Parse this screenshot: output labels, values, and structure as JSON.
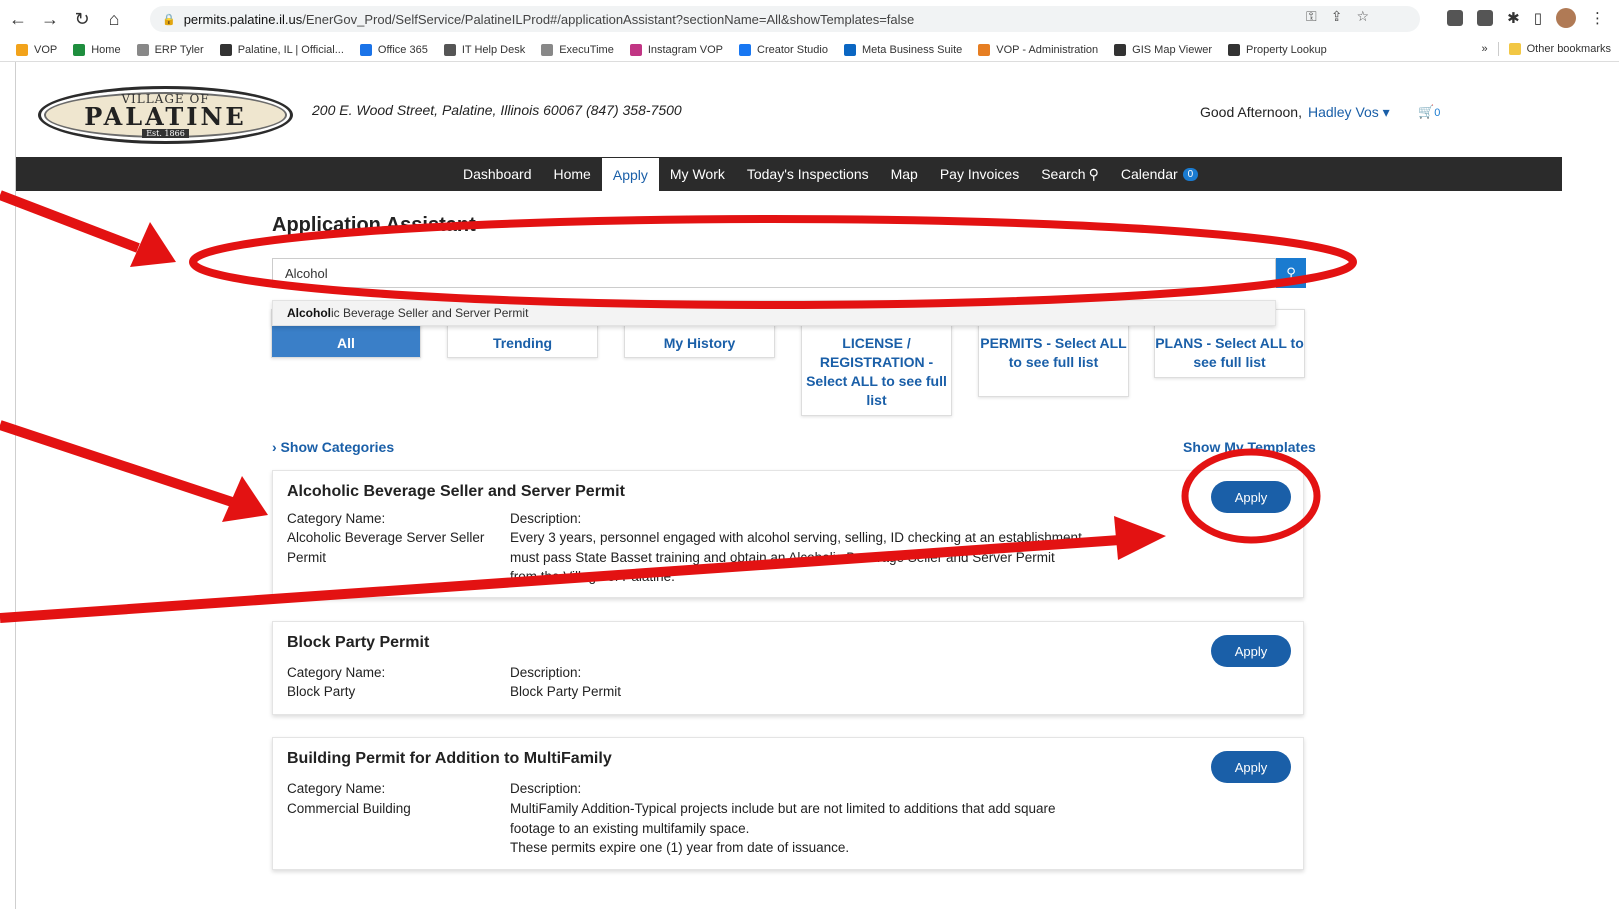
{
  "browser": {
    "url_host": "permits.palatine.il.us",
    "url_path": "/EnerGov_Prod/SelfService/PalatineILProd#/applicationAssistant?sectionName=All&showTemplates=false",
    "bookmarks": [
      {
        "label": "VOP",
        "color": "#f2a31b"
      },
      {
        "label": "Home",
        "color": "#1e8e3e"
      },
      {
        "label": "ERP Tyler",
        "color": "#888888"
      },
      {
        "label": "Palatine, IL | Official...",
        "color": "#333333"
      },
      {
        "label": "Office 365",
        "color": "#1a73e8"
      },
      {
        "label": "IT Help Desk",
        "color": "#555555"
      },
      {
        "label": "ExecuTime",
        "color": "#888888"
      },
      {
        "label": "Instagram VOP",
        "color": "#c13584"
      },
      {
        "label": "Creator Studio",
        "color": "#1877f2"
      },
      {
        "label": "Meta Business Suite",
        "color": "#0a66c2"
      },
      {
        "label": "VOP - Administration",
        "color": "#e67e22"
      },
      {
        "label": "GIS Map Viewer",
        "color": "#333333"
      },
      {
        "label": "Property Lookup",
        "color": "#333333"
      }
    ],
    "bookmarks_overflow": "»",
    "other_bookmarks": "Other bookmarks"
  },
  "header": {
    "logo_line1": "VILLAGE OF",
    "logo_line2": "PALATINE",
    "logo_line3": "Est. 1866",
    "address": "200 E. Wood Street, Palatine, Illinois 60067  (847) 358-7500",
    "greeting": "Good Afternoon,",
    "user_name": "Hadley Vos",
    "cart_count": "0"
  },
  "nav": {
    "items": [
      "Dashboard",
      "Home",
      "Apply",
      "My Work",
      "Today's Inspections",
      "Map",
      "Pay Invoices",
      "Search"
    ],
    "calendar_label": "Calendar",
    "calendar_count": "0"
  },
  "main": {
    "title": "Application Assistant",
    "search_value": "Alcohol",
    "suggestion_match": "Alcohol",
    "suggestion_rest": "ic Beverage Seller and Server Permit",
    "tiles": [
      {
        "label": "All"
      },
      {
        "label": "Trending"
      },
      {
        "label": "My History"
      },
      {
        "label": "LICENSE / REGISTRATION - Select ALL to see full list"
      },
      {
        "label": "PERMITS - Select ALL to see full list"
      },
      {
        "label": "PLANS - Select ALL to see full list"
      }
    ],
    "show_categories": "› Show Categories",
    "show_templates": "Show My Templates",
    "category_label": "Category Name:",
    "description_label": "Description:",
    "apply_label": "Apply",
    "results": [
      {
        "title": "Alcoholic Beverage Seller and Server Permit",
        "category": "Alcoholic Beverage Server Seller Permit",
        "description": "Every 3 years, personnel engaged with alcohol serving, selling, ID checking at an establishment must pass State Basset training and obtain an Alcoholic Beverage Seller and Server Permit from the Village of Palatine."
      },
      {
        "title": "Block Party Permit",
        "category": "Block Party",
        "description": "Block Party Permit"
      },
      {
        "title": "Building Permit for Addition to MultiFamily",
        "category": "Commercial Building",
        "description": "MultiFamily Addition-Typical projects include but are not limited to additions that add square footage to an existing multifamily space.",
        "description2": "These permits expire one (1) year from date of issuance."
      }
    ]
  },
  "annotation_color": "#e31212"
}
